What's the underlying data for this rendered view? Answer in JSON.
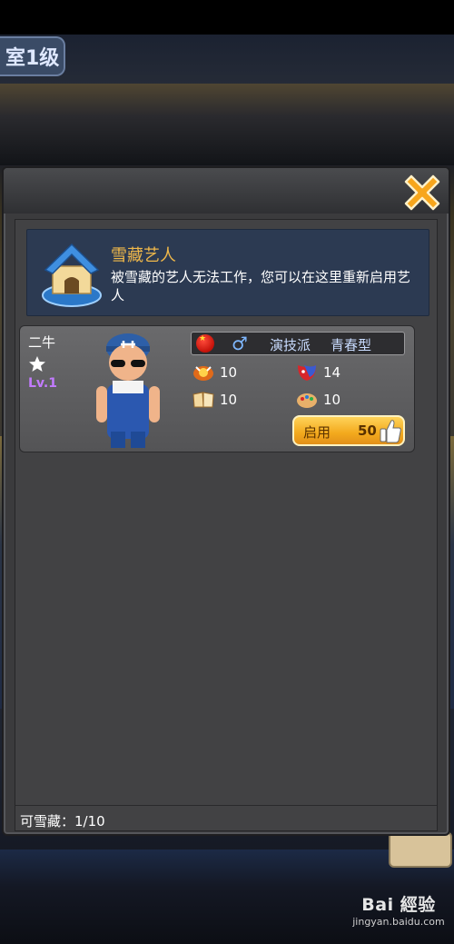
{
  "scene": {
    "floor_label": "室1级",
    "watermark_logo": "Bai 經验",
    "watermark_url": "jingyan.baidu.com"
  },
  "dialog": {
    "close_icon": "close-x-icon",
    "banner": {
      "icon": "doghouse-icon",
      "title": "雪藏艺人",
      "description": "被雪藏的艺人无法工作，您可以在这里重新启用艺人"
    },
    "artists": [
      {
        "name": "二牛",
        "stars": 1,
        "level": "Lv.1",
        "nationality_icon": "china-flag-icon",
        "gender_icon": "male-icon",
        "gender_symbol": "♂",
        "type": "演技派",
        "style": "青春型",
        "stats": [
          {
            "icon": "performance-icon",
            "value": "10"
          },
          {
            "icon": "mask-icon",
            "value": "14"
          },
          {
            "icon": "book-icon",
            "value": "10"
          },
          {
            "icon": "palette-icon",
            "value": "10"
          }
        ],
        "enable_button": {
          "label": "启用",
          "cost": "50",
          "icon": "thumbs-up-icon"
        }
      }
    ],
    "capacity": "可雪藏：1/10"
  },
  "colors": {
    "title_gold": "#f0b84a",
    "level_purple": "#c27bff",
    "banner_bg": "#2c3a52",
    "button_gold": "#f3a91c"
  }
}
